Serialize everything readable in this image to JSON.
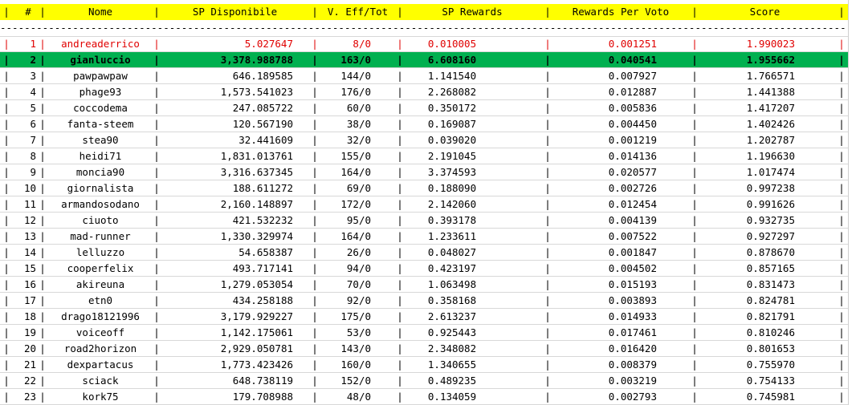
{
  "table": {
    "separator": "|",
    "divider": "--------------------------------------------------------------------------------------------------------------------------------------------",
    "columns": [
      "#",
      "Nome",
      "SP Disponibile",
      "V. Eff/Tot",
      "SP Rewards",
      "Rewards Per Voto",
      "Score"
    ],
    "rows": [
      {
        "rank": "1",
        "nome": "andreaderrico",
        "sp": "5.027647",
        "votes": "8/0",
        "rewards": "0.010005",
        "per_voto": "0.001251",
        "score": "1.990023",
        "style": "red"
      },
      {
        "rank": "2",
        "nome": "gianluccio",
        "sp": "3,378.988788",
        "votes": "163/0",
        "rewards": "6.608160",
        "per_voto": "0.040541",
        "score": "1.955662",
        "style": "green"
      },
      {
        "rank": "3",
        "nome": "pawpawpaw",
        "sp": "646.189585",
        "votes": "144/0",
        "rewards": "1.141540",
        "per_voto": "0.007927",
        "score": "1.766571",
        "style": ""
      },
      {
        "rank": "4",
        "nome": "phage93",
        "sp": "1,573.541023",
        "votes": "176/0",
        "rewards": "2.268082",
        "per_voto": "0.012887",
        "score": "1.441388",
        "style": ""
      },
      {
        "rank": "5",
        "nome": "coccodema",
        "sp": "247.085722",
        "votes": "60/0",
        "rewards": "0.350172",
        "per_voto": "0.005836",
        "score": "1.417207",
        "style": ""
      },
      {
        "rank": "6",
        "nome": "fanta-steem",
        "sp": "120.567190",
        "votes": "38/0",
        "rewards": "0.169087",
        "per_voto": "0.004450",
        "score": "1.402426",
        "style": ""
      },
      {
        "rank": "7",
        "nome": "stea90",
        "sp": "32.441609",
        "votes": "32/0",
        "rewards": "0.039020",
        "per_voto": "0.001219",
        "score": "1.202787",
        "style": ""
      },
      {
        "rank": "8",
        "nome": "heidi71",
        "sp": "1,831.013761",
        "votes": "155/0",
        "rewards": "2.191045",
        "per_voto": "0.014136",
        "score": "1.196630",
        "style": ""
      },
      {
        "rank": "9",
        "nome": "moncia90",
        "sp": "3,316.637345",
        "votes": "164/0",
        "rewards": "3.374593",
        "per_voto": "0.020577",
        "score": "1.017474",
        "style": ""
      },
      {
        "rank": "10",
        "nome": "giornalista",
        "sp": "188.611272",
        "votes": "69/0",
        "rewards": "0.188090",
        "per_voto": "0.002726",
        "score": "0.997238",
        "style": ""
      },
      {
        "rank": "11",
        "nome": "armandosodano",
        "sp": "2,160.148897",
        "votes": "172/0",
        "rewards": "2.142060",
        "per_voto": "0.012454",
        "score": "0.991626",
        "style": ""
      },
      {
        "rank": "12",
        "nome": "ciuoto",
        "sp": "421.532232",
        "votes": "95/0",
        "rewards": "0.393178",
        "per_voto": "0.004139",
        "score": "0.932735",
        "style": ""
      },
      {
        "rank": "13",
        "nome": "mad-runner",
        "sp": "1,330.329974",
        "votes": "164/0",
        "rewards": "1.233611",
        "per_voto": "0.007522",
        "score": "0.927297",
        "style": ""
      },
      {
        "rank": "14",
        "nome": "lelluzzo",
        "sp": "54.658387",
        "votes": "26/0",
        "rewards": "0.048027",
        "per_voto": "0.001847",
        "score": "0.878670",
        "style": ""
      },
      {
        "rank": "15",
        "nome": "cooperfelix",
        "sp": "493.717141",
        "votes": "94/0",
        "rewards": "0.423197",
        "per_voto": "0.004502",
        "score": "0.857165",
        "style": ""
      },
      {
        "rank": "16",
        "nome": "akireuna",
        "sp": "1,279.053054",
        "votes": "70/0",
        "rewards": "1.063498",
        "per_voto": "0.015193",
        "score": "0.831473",
        "style": ""
      },
      {
        "rank": "17",
        "nome": "etn0",
        "sp": "434.258188",
        "votes": "92/0",
        "rewards": "0.358168",
        "per_voto": "0.003893",
        "score": "0.824781",
        "style": ""
      },
      {
        "rank": "18",
        "nome": "drago18121996",
        "sp": "3,179.929227",
        "votes": "175/0",
        "rewards": "2.613237",
        "per_voto": "0.014933",
        "score": "0.821791",
        "style": ""
      },
      {
        "rank": "19",
        "nome": "voiceoff",
        "sp": "1,142.175061",
        "votes": "53/0",
        "rewards": "0.925443",
        "per_voto": "0.017461",
        "score": "0.810246",
        "style": ""
      },
      {
        "rank": "20",
        "nome": "road2horizon",
        "sp": "2,929.050781",
        "votes": "143/0",
        "rewards": "2.348082",
        "per_voto": "0.016420",
        "score": "0.801653",
        "style": ""
      },
      {
        "rank": "21",
        "nome": "dexpartacus",
        "sp": "1,773.423426",
        "votes": "160/0",
        "rewards": "1.340655",
        "per_voto": "0.008379",
        "score": "0.755970",
        "style": ""
      },
      {
        "rank": "22",
        "nome": "sciack",
        "sp": "648.738119",
        "votes": "152/0",
        "rewards": "0.489235",
        "per_voto": "0.003219",
        "score": "0.754133",
        "style": ""
      },
      {
        "rank": "23",
        "nome": "kork75",
        "sp": "179.708988",
        "votes": "48/0",
        "rewards": "0.134059",
        "per_voto": "0.002793",
        "score": "0.745981",
        "style": ""
      }
    ]
  }
}
